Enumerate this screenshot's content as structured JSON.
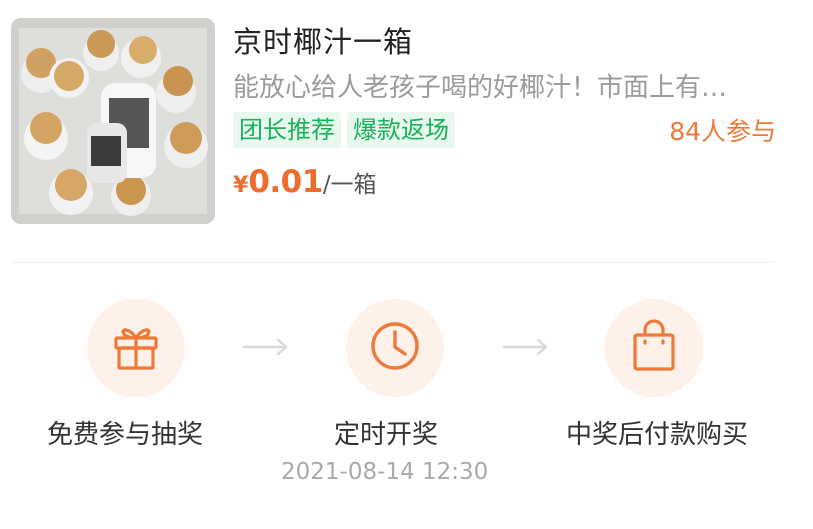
{
  "product": {
    "title": "京时椰汁一箱",
    "description": "能放心给人老孩子喝的好椰汁！市面上有…",
    "tags": [
      "团长推荐",
      "爆款返场"
    ],
    "participants": "84人参与",
    "price_currency": "¥",
    "price_amount": "0.01",
    "price_unit": "/一箱"
  },
  "steps": [
    {
      "label": "免费参与抽奖",
      "icon": "gift-icon"
    },
    {
      "label": "定时开奖",
      "icon": "clock-icon"
    },
    {
      "label": "中奖后付款购买",
      "icon": "shopping-bag-icon"
    }
  ],
  "draw_time": "2021-08-14 12:30",
  "colors": {
    "accent_orange": "#ee7a3a",
    "price_orange": "#ee6c2d",
    "tag_green": "#18b45a",
    "tag_bg": "#e9f8ef",
    "icon_circle_bg": "#fdf1ea"
  }
}
